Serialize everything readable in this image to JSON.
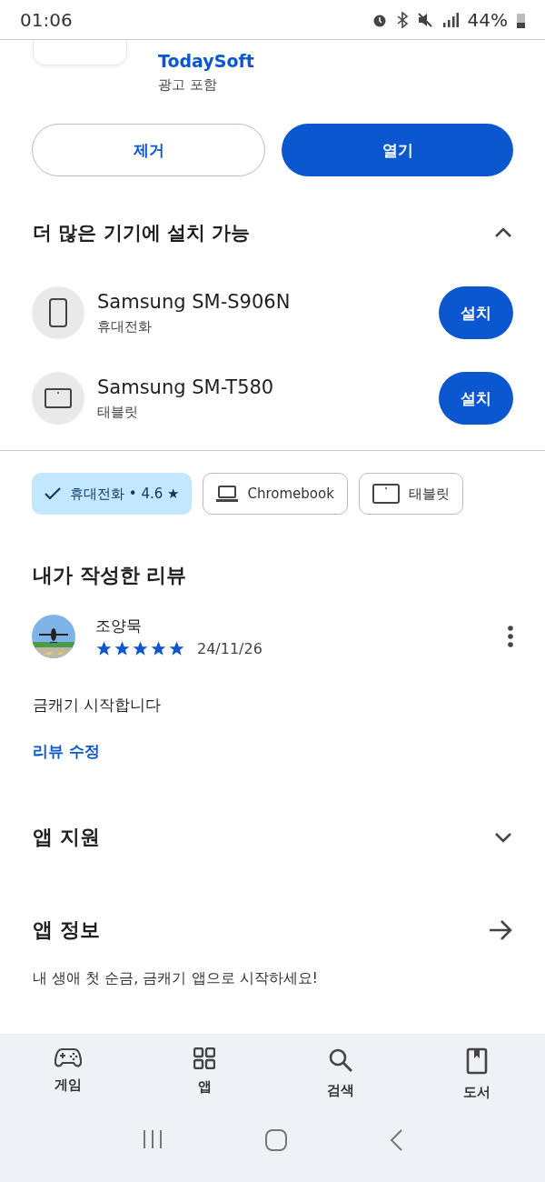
{
  "status_bar": {
    "time": "01:06",
    "battery": "44%"
  },
  "app": {
    "developer": "TodaySoft",
    "ads_note": "광고 포함"
  },
  "actions": [
    {
      "label": "제거",
      "kind": "outline"
    },
    {
      "label": "열기",
      "kind": "filled"
    }
  ],
  "devices_section": {
    "title": "더 많은 기기에 설치 가능",
    "expanded": true,
    "devices": [
      {
        "name": "Samsung SM-S906N",
        "type": "휴대전화",
        "kind": "phone",
        "button": "설치"
      },
      {
        "name": "Samsung SM-T580",
        "type": "태블릿",
        "kind": "tablet",
        "button": "설치"
      }
    ]
  },
  "filter_chips": [
    {
      "label": "휴대전화 • 4.6 ★",
      "selected": true
    },
    {
      "label": "Chromebook",
      "kind": "laptop",
      "selected": false
    },
    {
      "label": "태블릿",
      "kind": "tablet",
      "selected": false
    }
  ],
  "my_review": {
    "title": "내가 작성한 리뷰",
    "author": "조양묵",
    "stars": 5,
    "date": "24/11/26",
    "text": "금캐기 시작합니다",
    "edit_link": "리뷰 수정"
  },
  "app_support": {
    "title": "앱 지원",
    "expanded": false
  },
  "app_info": {
    "title": "앱 정보",
    "description": "내 생애 첫 순금, 금캐기 앱으로 시작하세요!"
  },
  "bottom_nav": [
    {
      "label": "게임",
      "kind": "games"
    },
    {
      "label": "앱",
      "kind": "apps"
    },
    {
      "label": "검색",
      "kind": "search"
    },
    {
      "label": "도서",
      "kind": "books"
    }
  ]
}
